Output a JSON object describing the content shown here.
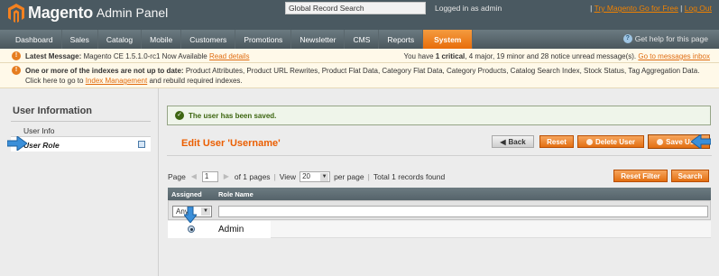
{
  "header": {
    "logo_word": "Magento",
    "logo_sub": "Admin Panel",
    "search_value": "Global Record Search",
    "logged_in": "Logged in as admin",
    "try_link": "Try Magento Go for Free",
    "logout_link": "Log Out"
  },
  "nav": {
    "items": [
      "Dashboard",
      "Sales",
      "Catalog",
      "Mobile",
      "Customers",
      "Promotions",
      "Newsletter",
      "CMS",
      "Reports",
      "System"
    ],
    "active": "System",
    "help": "Get help for this page"
  },
  "notices": {
    "latest_label": "Latest Message:",
    "latest_text": "Magento CE 1.5.1.0-rc1 Now Available",
    "latest_link": "Read details",
    "counts_prefix": "You have",
    "counts_critical": "1 critical",
    "counts_major": "4 major",
    "counts_minor": "19 minor",
    "counts_notice": "and 28 notice unread message(s).",
    "messages_link": "Go to messages inbox",
    "index_bold": "One or more of the indexes are not up to date:",
    "index_text": "Product Attributes, Product URL Rewrites, Product Flat Data, Category Flat Data, Category Products, Catalog Search Index, Stock Status, Tag Aggregation Data. Click here to go to",
    "index_link": "Index Management",
    "index_tail": "and rebuild required indexes."
  },
  "sidebar": {
    "title": "User Information",
    "items": [
      "User Info",
      "User Role"
    ]
  },
  "main": {
    "success": "The user has been saved.",
    "title": "Edit User 'Username'",
    "buttons": {
      "back": "Back",
      "reset": "Reset",
      "delete": "Delete User",
      "save": "Save User",
      "reset_filter": "Reset Filter",
      "search": "Search"
    },
    "pager": {
      "page_label": "Page",
      "page_value": "1",
      "of_pages": "of 1 pages",
      "view_label": "View",
      "view_value": "20",
      "per_page": "per page",
      "total": "Total 1 records found"
    },
    "grid": {
      "col_assigned": "Assigned",
      "col_role": "Role Name",
      "filter_assigned": "Any",
      "rows": [
        {
          "role": "Admin"
        }
      ]
    }
  },
  "colors": {
    "accent": "#eb5e00",
    "nav_active": "#e86d0a",
    "header_bg": "#4a5961"
  }
}
